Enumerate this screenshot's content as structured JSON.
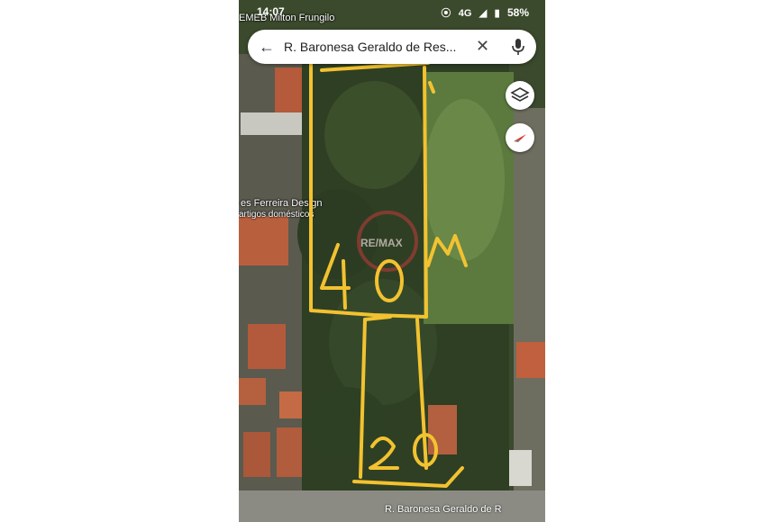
{
  "status_bar": {
    "time": "14:07",
    "battery": "58%",
    "network": "4G"
  },
  "map": {
    "poi_top": "EMEB Milton Frungilo",
    "poi_business": "es Ferreira Design",
    "poi_business_sub": "artigos domésticos",
    "watermark": "RE/MAX",
    "street_label": "R. Baronesa Geraldo de R"
  },
  "search": {
    "query": "R. Baronesa Geraldo de Res..."
  },
  "annotations": {
    "color": "#f2c230",
    "length_label": "40M",
    "width_label": "20"
  },
  "icons": {
    "back": "back-arrow-icon",
    "clear": "close-icon",
    "mic": "microphone-icon",
    "layers": "layers-icon",
    "compass": "compass-icon"
  }
}
